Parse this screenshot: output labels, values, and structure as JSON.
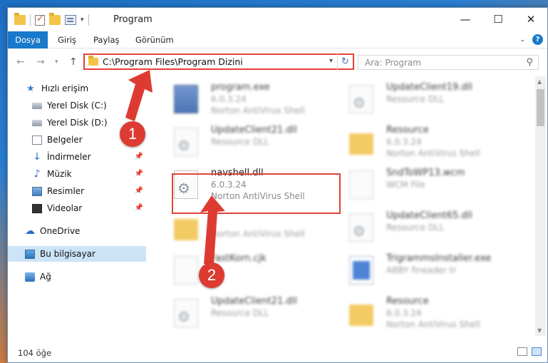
{
  "window": {
    "title": "Program",
    "buttons": {
      "minimize": "—",
      "maximize": "☐",
      "close": "✕"
    }
  },
  "ribbon": {
    "file_tab": "Dosya",
    "tabs": [
      "Giriş",
      "Paylaş",
      "Görünüm"
    ]
  },
  "address": {
    "path": "C:\\Program Files\\Program Dizini",
    "search_placeholder": "Ara: Program"
  },
  "sidebar": {
    "items": [
      {
        "label": "Hızlı erişim",
        "icon": "star-icon"
      },
      {
        "label": "Yerel Disk (C:)",
        "icon": "drive-icon"
      },
      {
        "label": "Yerel Disk (D:)",
        "icon": "drive-icon"
      },
      {
        "label": "Belgeler",
        "icon": "documents-icon"
      },
      {
        "label": "İndirmeler",
        "icon": "download-icon"
      },
      {
        "label": "Müzik",
        "icon": "music-icon"
      },
      {
        "label": "Resimler",
        "icon": "pictures-icon"
      },
      {
        "label": "Videolar",
        "icon": "video-icon"
      },
      {
        "label": "OneDrive",
        "icon": "cloud-icon"
      },
      {
        "label": "Bu bilgisayar",
        "icon": "computer-icon"
      },
      {
        "label": "Ağ",
        "icon": "network-icon"
      }
    ]
  },
  "files": [
    {
      "name": "program.exe",
      "line2": "6.0.3.24",
      "line3": "Norton AntiVirus Shell"
    },
    {
      "name": "UpdateClient19.dll",
      "line2": "Resource DLL",
      "line3": ""
    },
    {
      "name": "UpdateClient21.dll",
      "line2": "Resource DLL",
      "line3": ""
    },
    {
      "name": "Resource",
      "line2": "6.0.3.24",
      "line3": "Norton AntiVirus Shell"
    },
    {
      "name": "navshell.dll",
      "line2": "6.0.3.24",
      "line3": "Norton AntiVirus Shell"
    },
    {
      "name": "SndToWP13.wcm",
      "line2": "WCM File",
      "line3": ""
    },
    {
      "name": "",
      "line2": "",
      "line3": "Norton AntiVirus Shell"
    },
    {
      "name": "UpdateClient65.dll",
      "line2": "Resource DLL",
      "line3": ""
    },
    {
      "name": "FastKorn.cjk",
      "line2": "",
      "line3": ""
    },
    {
      "name": "TrigrammsInstaller.exe",
      "line2": "ABBY fineader tr",
      "line3": ""
    },
    {
      "name": "UpdateClient21.dll",
      "line2": "Resource DLL",
      "line3": ""
    },
    {
      "name": "Resource",
      "line2": "6.0.3.24",
      "line3": "Norton AntiVirus Shell"
    }
  ],
  "status": {
    "count": "104 öğe"
  },
  "annotations": {
    "step1": "1",
    "step2": "2"
  },
  "colors": {
    "accent": "#1979ca",
    "highlight": "#e04438"
  }
}
